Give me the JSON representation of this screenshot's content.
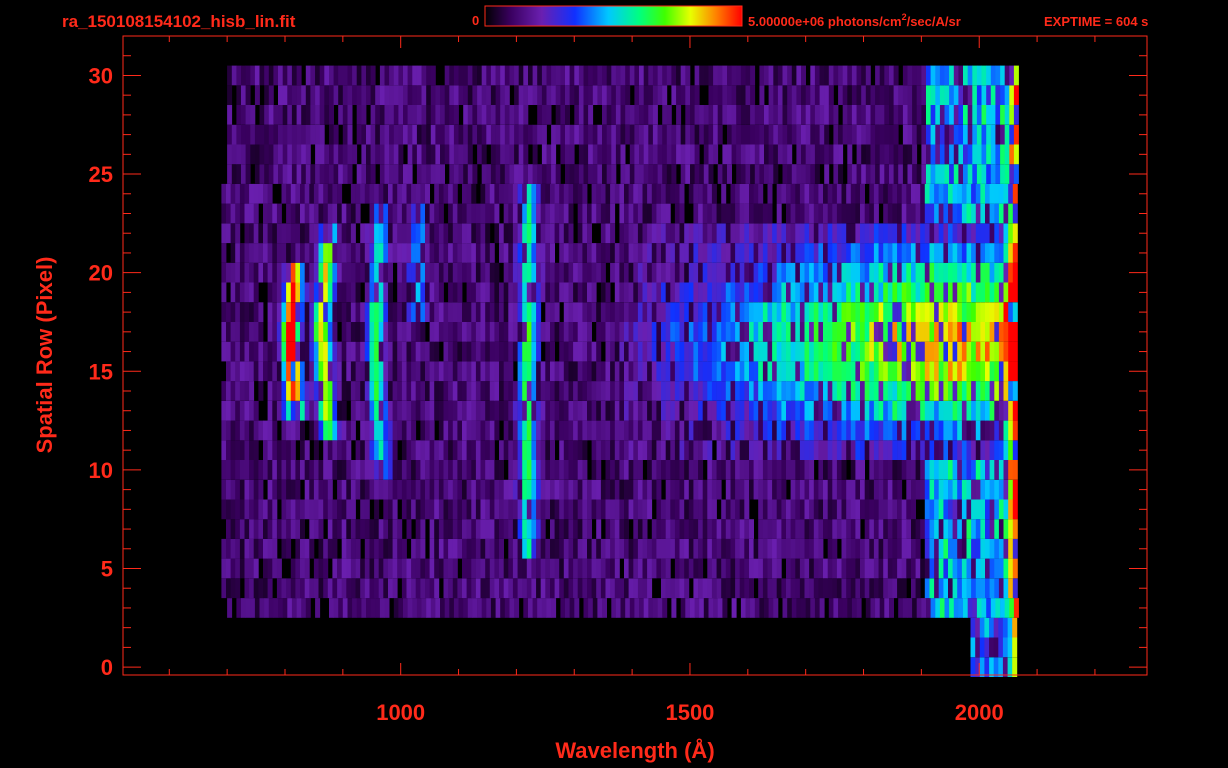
{
  "header": {
    "filename": "ra_150108154102_hisb_lin.fit",
    "colorbar_min_label": "0",
    "colorbar_max_label": "5.00000e+06 photons/cm",
    "colorbar_unit_superscript": "2",
    "colorbar_unit_tail": "/sec/A/sr",
    "exptime_label": "EXPTIME = 604 s"
  },
  "colors": {
    "axis": "#ff2a1a",
    "background": "#000000",
    "colormap": [
      "#000000",
      "#3a0060",
      "#6a1fb0",
      "#1030ff",
      "#00c8ff",
      "#00ff80",
      "#40ff00",
      "#e8ff00",
      "#ff8000",
      "#ff0000"
    ]
  },
  "chart_data": {
    "type": "heatmap",
    "title": "ra_150108154102_hisb_lin.fit",
    "xlabel": "Wavelength (Å)",
    "ylabel": "Spatial Row (Pixel)",
    "xlim": [
      520,
      2290
    ],
    "ylim": [
      -0.4,
      32
    ],
    "xticks": [
      1000,
      1500,
      2000
    ],
    "yticks": [
      0,
      5,
      10,
      15,
      20,
      25,
      30
    ],
    "xtick_labels": [
      "1000",
      "1500",
      "2000"
    ],
    "ytick_labels": [
      "0",
      "5",
      "10",
      "15",
      "20",
      "25",
      "30"
    ],
    "value_range": [
      0,
      5000000
    ],
    "value_unit": "photons/cm^2/sec/A/sr",
    "rows": [
      0,
      30
    ],
    "wavelength_coverage": [
      690,
      2065
    ],
    "features": [
      {
        "wavelength": 805,
        "rows": [
          13,
          20
        ],
        "peak": 1.0
      },
      {
        "wavelength": 860,
        "rows": [
          12,
          22
        ],
        "peak": 0.7
      },
      {
        "wavelength": 950,
        "rows": [
          10,
          23
        ],
        "peak": 0.45
      },
      {
        "wavelength": 1026,
        "rows": [
          18,
          23
        ],
        "peak": 0.3
      },
      {
        "wavelength": 1216,
        "rows": [
          6,
          24
        ],
        "peak": 0.5
      },
      {
        "wavelength": 2060,
        "rows": [
          0,
          30
        ],
        "peak": 0.6
      }
    ],
    "continuum": {
      "start": 1500,
      "end": 2060,
      "rows": [
        11,
        22
      ],
      "peak": 0.72,
      "peak_row": 16.5
    }
  }
}
